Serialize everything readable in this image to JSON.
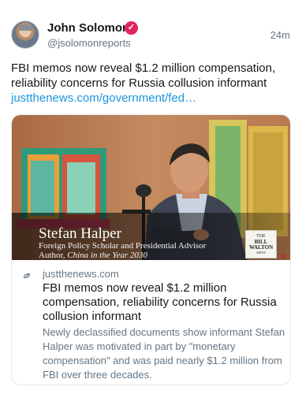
{
  "author": {
    "name": "John Solomon",
    "handle": "@jsolomonreports",
    "verified_glyph": "✓",
    "verified_color": "#e0245e",
    "timestamp": "24m"
  },
  "tweet": {
    "text": "FBI memos now reveal $1.2 million compensation, reliability concerns for Russia collusion informant",
    "link": "justthenews.com/government/fed…"
  },
  "card": {
    "image": {
      "speaker_name": "Stefan Halper",
      "speaker_title": "Foreign Policy Scholar and Presidential Advisor",
      "speaker_author_prefix": "Author, ",
      "speaker_book": "China in the Year 2030",
      "logo": {
        "line1": "THE",
        "line2": "BILL",
        "line3": "WALTON",
        "line4": "SHOW"
      }
    },
    "domain_icon": "link-icon",
    "domain": "justthenews.com",
    "title": "FBI memos now reveal $1.2 million compensation, reliability concerns for Russia collusion informant",
    "description": "Newly declassified documents show informant Stefan Halper was motivated in part by \"monetary compensation\" and was paid nearly $1.2 million from FBI over three decades."
  },
  "colors": {
    "text": "#14171a",
    "secondary": "#657786",
    "link": "#1b95e0",
    "border": "#e1e8ed"
  }
}
